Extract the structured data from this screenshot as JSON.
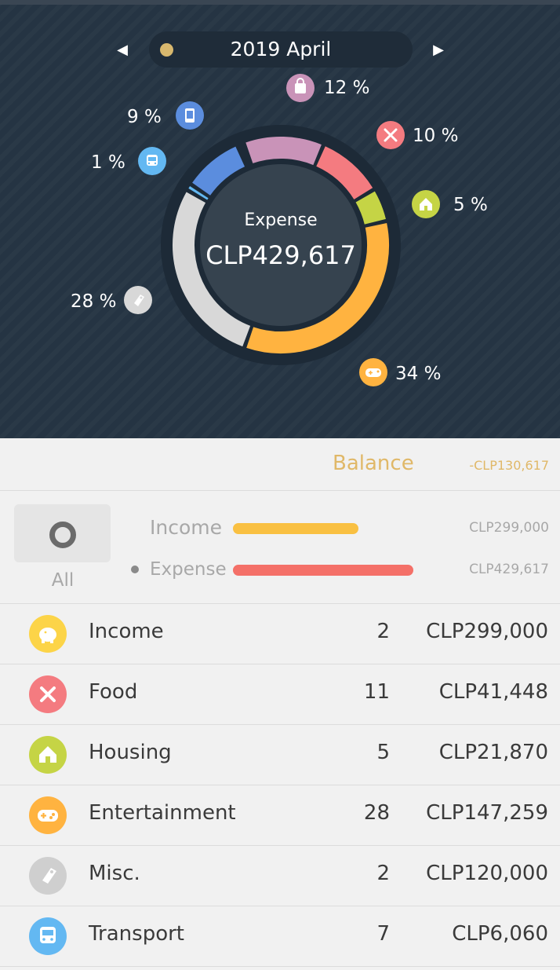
{
  "header": {
    "month": "2019 April",
    "prev_arrow": "◀",
    "next_arrow": "▶",
    "dot_color": "#d8b86e"
  },
  "donut": {
    "center_title": "Expense",
    "center_value": "CLP429,617",
    "segments": [
      {
        "category": "Shopping",
        "percent_label": "12 %",
        "color": "#c993b8",
        "icon": "shopping-bag-icon"
      },
      {
        "category": "Food",
        "percent_label": "10 %",
        "color": "#f47b80",
        "icon": "fork-knife-icon"
      },
      {
        "category": "Housing",
        "percent_label": "5 %",
        "color": "#c5d445",
        "icon": "house-icon"
      },
      {
        "category": "Entertainment",
        "percent_label": "34 %",
        "color": "#ffb340",
        "icon": "gamepad-icon"
      },
      {
        "category": "Misc.",
        "percent_label": "28 %",
        "color": "#d8d8d8",
        "icon": "tag-icon"
      },
      {
        "category": "Transport",
        "percent_label": "1 %",
        "color": "#63b8f2",
        "icon": "bus-icon"
      },
      {
        "category": "Phone",
        "percent_label": "9 %",
        "color": "#5b8dde",
        "icon": "phone-icon"
      }
    ]
  },
  "balance": {
    "label": "Balance",
    "value": "-CLP130,617",
    "color": "#e0b868"
  },
  "summary": {
    "all_label": "All",
    "income_label": "Income",
    "income_value": "CLP299,000",
    "income_color": "#f9c042",
    "expense_label": "Expense",
    "expense_value": "CLP429,617",
    "expense_color": "#f47068"
  },
  "categories": [
    {
      "name": "Income",
      "count": "2",
      "amount": "CLP299,000",
      "color": "#fcd448",
      "icon": "piggy-bank-icon"
    },
    {
      "name": "Food",
      "count": "11",
      "amount": "CLP41,448",
      "color": "#f47b80",
      "icon": "fork-knife-icon"
    },
    {
      "name": "Housing",
      "count": "5",
      "amount": "CLP21,870",
      "color": "#c5d445",
      "icon": "house-icon"
    },
    {
      "name": "Entertainment",
      "count": "28",
      "amount": "CLP147,259",
      "color": "#ffb340",
      "icon": "gamepad-icon"
    },
    {
      "name": "Misc.",
      "count": "2",
      "amount": "CLP120,000",
      "color": "#cfcfcf",
      "icon": "tag-icon"
    },
    {
      "name": "Transport",
      "count": "7",
      "amount": "CLP6,060",
      "color": "#63b8f2",
      "icon": "bus-icon"
    }
  ]
}
